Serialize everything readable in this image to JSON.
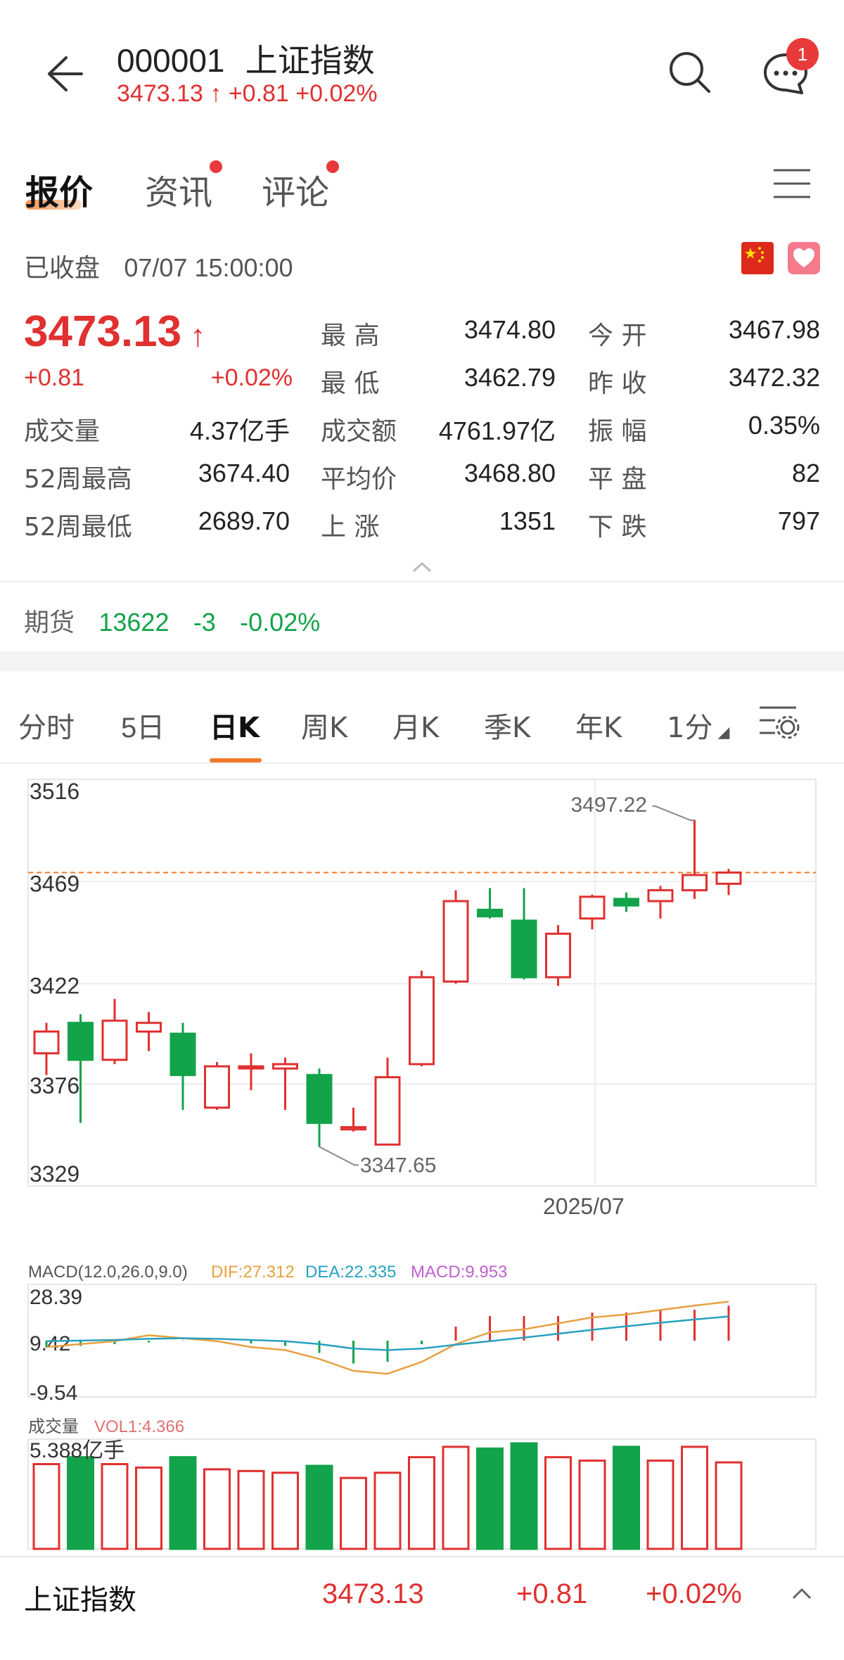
{
  "header": {
    "code": "000001",
    "name": "上证指数",
    "price": "3473.13",
    "change": "+0.81",
    "change_pct": "+0.02%",
    "notification_count": "1"
  },
  "tabs": [
    {
      "label": "报价",
      "active": true,
      "dot": false
    },
    {
      "label": "资讯",
      "active": false,
      "dot": true
    },
    {
      "label": "评论",
      "active": false,
      "dot": true
    }
  ],
  "status": {
    "state": "已收盘",
    "datetime": "07/07 15:00:00"
  },
  "quote": {
    "price": "3473.13",
    "change": "+0.81",
    "change_pct": "+0.02%",
    "stats": [
      {
        "label": "最 高",
        "value": "3474.80"
      },
      {
        "label": "今 开",
        "value": "3467.98"
      },
      {
        "label": "最 低",
        "value": "3462.79"
      },
      {
        "label": "昨 收",
        "value": "3472.32"
      },
      {
        "label": "成交量",
        "value": "4.37亿手"
      },
      {
        "label": "成交额",
        "value": "4761.97亿"
      },
      {
        "label": "振 幅",
        "value": "0.35%"
      },
      {
        "label": "52周最高",
        "value": "3674.40"
      },
      {
        "label": "平均价",
        "value": "3468.80"
      },
      {
        "label": "平 盘",
        "value": "82"
      },
      {
        "label": "52周最低",
        "value": "2689.70"
      },
      {
        "label": "上 涨",
        "value": "1351"
      },
      {
        "label": "下 跌",
        "value": "797"
      }
    ]
  },
  "futures": {
    "label": "期货",
    "value": "13622",
    "change": "-3",
    "change_pct": "-0.02%"
  },
  "period_tabs": [
    "分时",
    "5日",
    "日K",
    "周K",
    "月K",
    "季K",
    "年K",
    "1分"
  ],
  "active_period": "日K",
  "colors": {
    "up": "#e03030",
    "down": "#13a34a",
    "accent": "#f07a2a",
    "dif": "#e8a040",
    "dea": "#27a0c0",
    "macd": "#c060d0"
  },
  "chart_data": {
    "type": "candlestick",
    "y_ticks": [
      "3516",
      "3469",
      "3422",
      "3376",
      "3329"
    ],
    "ylim": [
      3329,
      3516
    ],
    "x_label": "2025/07",
    "high_annotation": "3497.22",
    "low_annotation": "3347.65",
    "current_line": 3473.13,
    "candles": [
      {
        "o": 3390,
        "h": 3404,
        "l": 3380,
        "c": 3400
      },
      {
        "o": 3404,
        "h": 3408,
        "l": 3358,
        "c": 3387
      },
      {
        "o": 3387,
        "h": 3415,
        "l": 3385,
        "c": 3405
      },
      {
        "o": 3400,
        "h": 3409,
        "l": 3391,
        "c": 3404
      },
      {
        "o": 3399,
        "h": 3404,
        "l": 3364,
        "c": 3380
      },
      {
        "o": 3365,
        "h": 3386,
        "l": 3364,
        "c": 3384
      },
      {
        "o": 3384,
        "h": 3390,
        "l": 3373,
        "c": 3384
      },
      {
        "o": 3383,
        "h": 3388,
        "l": 3364,
        "c": 3385
      },
      {
        "o": 3380,
        "h": 3383,
        "l": 3347,
        "c": 3358
      },
      {
        "o": 3355,
        "h": 3365,
        "l": 3354,
        "c": 3356
      },
      {
        "o": 3348,
        "h": 3388,
        "l": 3347.65,
        "c": 3379
      },
      {
        "o": 3385,
        "h": 3428,
        "l": 3384,
        "c": 3425
      },
      {
        "o": 3423,
        "h": 3465,
        "l": 3422,
        "c": 3460
      },
      {
        "o": 3456,
        "h": 3466,
        "l": 3452,
        "c": 3453
      },
      {
        "o": 3451,
        "h": 3466,
        "l": 3424,
        "c": 3425
      },
      {
        "o": 3425,
        "h": 3449,
        "l": 3421,
        "c": 3445
      },
      {
        "o": 3452,
        "h": 3463,
        "l": 3447,
        "c": 3462
      },
      {
        "o": 3461,
        "h": 3464,
        "l": 3455,
        "c": 3458
      },
      {
        "o": 3460,
        "h": 3467,
        "l": 3452,
        "c": 3465
      },
      {
        "o": 3465,
        "h": 3497.22,
        "l": 3461,
        "c": 3472
      },
      {
        "o": 3467.98,
        "h": 3474.8,
        "l": 3462.79,
        "c": 3473.13
      }
    ]
  },
  "macd": {
    "title": "MACD(12.0,26.0,9.0)",
    "dif_label": "DIF:27.312",
    "dea_label": "DEA:22.335",
    "macd_label": "MACD:9.953",
    "y_ticks": [
      "28.39",
      "9.42",
      "-9.54"
    ],
    "range": [
      -9.54,
      28.39
    ],
    "dif": [
      12,
      13,
      14,
      16,
      15,
      14,
      12,
      11,
      8,
      4,
      3,
      7,
      13,
      17,
      18,
      20,
      22,
      23,
      24.5,
      26,
      27.312
    ],
    "dea": [
      14,
      14.2,
      14.4,
      14.8,
      15,
      14.8,
      14.4,
      14,
      13,
      11.5,
      11,
      11.5,
      12.8,
      14,
      15.2,
      16.5,
      17.8,
      19,
      20.2,
      21.3,
      22.335
    ],
    "hist": [
      -2,
      -1.5,
      -1,
      -0.5,
      0.1,
      -0.2,
      -0.8,
      -1.5,
      -3.5,
      -6.5,
      -6,
      -1,
      4,
      7,
      7,
      7,
      8,
      8,
      8.5,
      8.8,
      9.953
    ]
  },
  "volume": {
    "title": "成交量",
    "vol_label": "VOL1:4.366",
    "max_label": "5.388亿手",
    "max": 5.388,
    "values": [
      4.9,
      5.3,
      4.9,
      4.7,
      5.3,
      4.6,
      4.5,
      4.4,
      4.8,
      4.1,
      4.4,
      5.3,
      5.9,
      5.8,
      6.1,
      5.3,
      5.1,
      5.9,
      5.1,
      5.9,
      5.0
    ]
  },
  "bottom_bar": {
    "name": "上证指数",
    "price": "3473.13",
    "change": "+0.81",
    "change_pct": "+0.02%"
  }
}
